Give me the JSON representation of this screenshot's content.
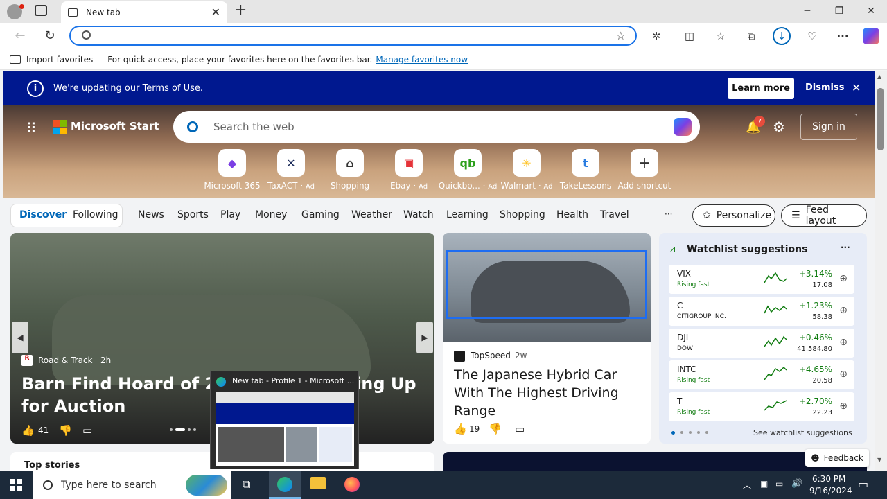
{
  "browser": {
    "tab_title": "New tab",
    "address_value": "",
    "favbar": {
      "import": "Import favorites",
      "hint": "For quick access, place your favorites here on the favorites bar.",
      "manage_link": "Manage favorites now"
    }
  },
  "notice": {
    "text": "We're updating our Terms of Use.",
    "learn_more": "Learn more",
    "dismiss": "Dismiss"
  },
  "header": {
    "brand": "Microsoft Start",
    "search_placeholder": "Search the web",
    "notif_count": "7",
    "sign_in": "Sign in"
  },
  "shortcuts": [
    {
      "label": "Microsoft 365",
      "ad": ""
    },
    {
      "label": "TaxACT",
      "ad": "Ad"
    },
    {
      "label": "Shopping",
      "ad": ""
    },
    {
      "label": "Ebay",
      "ad": "Ad"
    },
    {
      "label": "Quickbo...",
      "ad": "Ad"
    },
    {
      "label": "Walmart",
      "ad": "Ad"
    },
    {
      "label": "TakeLessons",
      "ad": ""
    },
    {
      "label": "Add shortcut",
      "ad": ""
    }
  ],
  "nav": {
    "discover": "Discover",
    "following": "Following",
    "items": [
      "News",
      "Sports",
      "Play",
      "Money",
      "Gaming",
      "Weather",
      "Watch",
      "Learning",
      "Shopping",
      "Health",
      "Travel"
    ],
    "more": "···",
    "personalize": "Personalize",
    "feed_layout": "Feed layout"
  },
  "main_story": {
    "source": "Road & Track",
    "age": "2h",
    "title": "Barn Find Hoard of 21 Ch",
    "title_end": "ing Up",
    "title_line2": "for Auction",
    "likes": "41"
  },
  "side_story": {
    "source": "TopSpeed",
    "age": "2w",
    "title": "The Japanese Hybrid Car With The Highest Driving Range",
    "likes": "19"
  },
  "watchlist": {
    "title": "Watchlist suggestions",
    "more": "···",
    "see_more": "See watchlist suggestions",
    "rows": [
      {
        "symbol": "VIX",
        "sub": "Rising fast",
        "change": "+3.14%",
        "price": "17.08"
      },
      {
        "symbol": "C",
        "sub": "CITIGROUP INC.",
        "change": "+1.23%",
        "price": "58.38"
      },
      {
        "symbol": "DJI",
        "sub": "DOW",
        "change": "+0.46%",
        "price": "41,584.80"
      },
      {
        "symbol": "INTC",
        "sub": "Rising fast",
        "change": "+4.65%",
        "price": "20.58"
      },
      {
        "symbol": "T",
        "sub": "Rising fast",
        "change": "+2.70%",
        "price": "22.23"
      }
    ]
  },
  "top_stories": "Top stories",
  "feedback": "Feedback",
  "thumbnail": {
    "title": "New tab - Profile 1 - Microsoft ..."
  },
  "taskbar": {
    "search_placeholder": "Type here to search",
    "time": "6:30 PM",
    "date": "9/16/2024"
  },
  "colors": {
    "accent": "#0067b8",
    "notice_bg": "#00188f",
    "up_green": "#107c10"
  }
}
